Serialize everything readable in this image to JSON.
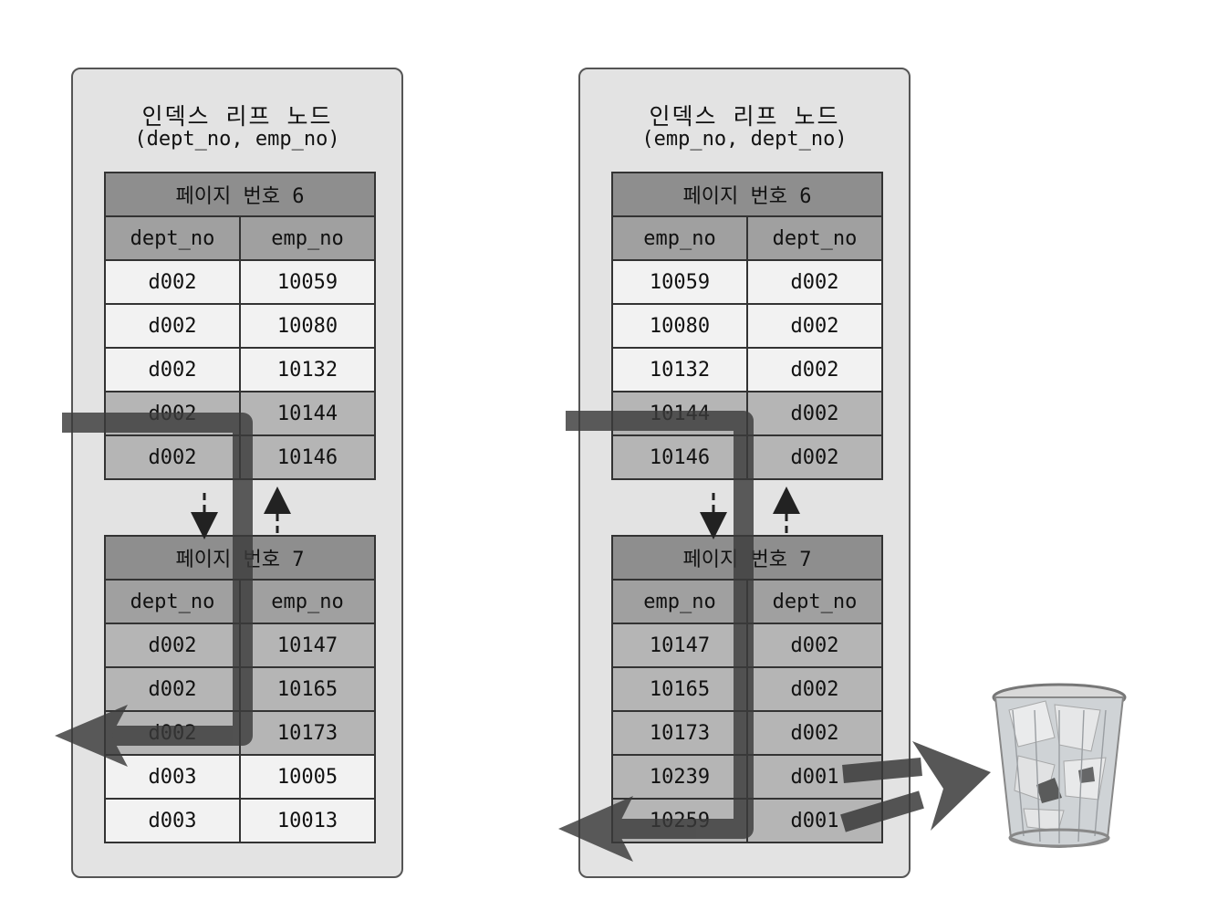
{
  "left": {
    "title": "인덱스 리프 노드",
    "subtitle": "(dept_no, emp_no)",
    "page6": {
      "header": "페이지 번호 6",
      "columns": [
        "dept_no",
        "emp_no"
      ],
      "rows": [
        [
          "d002",
          "10059"
        ],
        [
          "d002",
          "10080"
        ],
        [
          "d002",
          "10132"
        ],
        [
          "d002",
          "10144"
        ],
        [
          "d002",
          "10146"
        ]
      ],
      "highlighted_rows": [
        3,
        4
      ]
    },
    "page7": {
      "header": "페이지 번호 7",
      "columns": [
        "dept_no",
        "emp_no"
      ],
      "rows": [
        [
          "d002",
          "10147"
        ],
        [
          "d002",
          "10165"
        ],
        [
          "d002",
          "10173"
        ],
        [
          "d003",
          "10005"
        ],
        [
          "d003",
          "10013"
        ]
      ],
      "highlighted_rows": [
        0,
        1,
        2
      ]
    }
  },
  "right": {
    "title": "인덱스 리프 노드",
    "subtitle": "(emp_no, dept_no)",
    "page6": {
      "header": "페이지 번호 6",
      "columns": [
        "emp_no",
        "dept_no"
      ],
      "rows": [
        [
          "10059",
          "d002"
        ],
        [
          "10080",
          "d002"
        ],
        [
          "10132",
          "d002"
        ],
        [
          "10144",
          "d002"
        ],
        [
          "10146",
          "d002"
        ]
      ],
      "highlighted_rows": [
        3,
        4
      ]
    },
    "page7": {
      "header": "페이지 번호 7",
      "columns": [
        "emp_no",
        "dept_no"
      ],
      "rows": [
        [
          "10147",
          "d002"
        ],
        [
          "10165",
          "d002"
        ],
        [
          "10173",
          "d002"
        ],
        [
          "10239",
          "d001"
        ],
        [
          "10259",
          "d001"
        ]
      ],
      "highlighted_rows": [
        0,
        1,
        2,
        3,
        4
      ]
    }
  },
  "icons": [
    "dashed-down-arrow-icon",
    "dashed-up-arrow-icon",
    "scan-path-arrow-icon",
    "discard-arrow-icon",
    "trash-bin-icon"
  ],
  "colors": {
    "panel_bg": "#e3e3e3",
    "page_header": "#8e8e8e",
    "column_header": "#a0a0a0",
    "row_normal": "#f2f2f2",
    "row_highlight": "#b5b5b5",
    "scan_arrow": "#3a3a3a"
  }
}
